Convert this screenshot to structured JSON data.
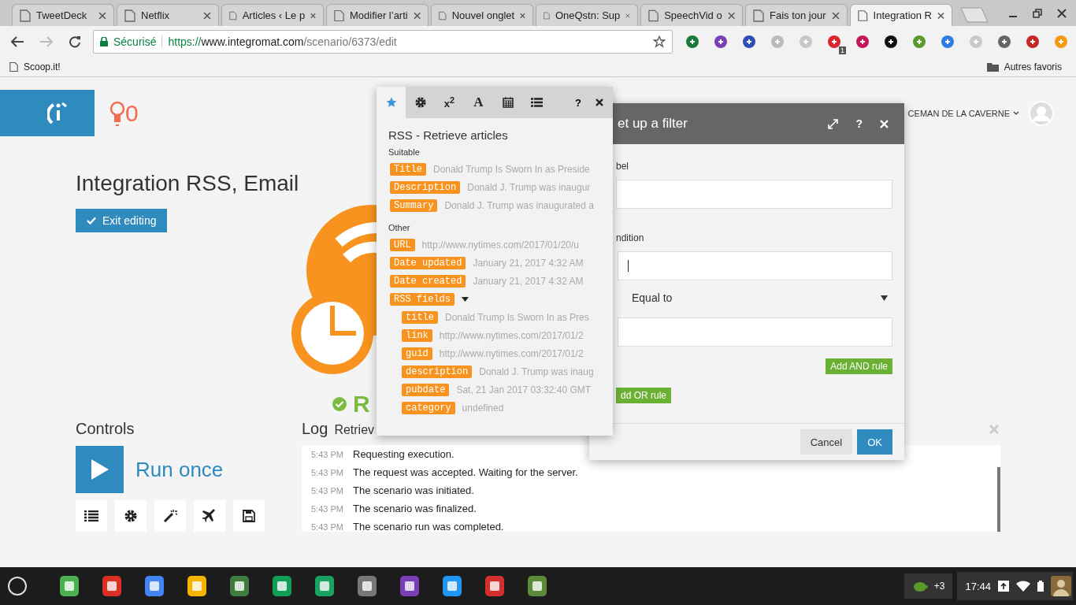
{
  "browser": {
    "tabs": [
      {
        "title": "TweetDeck",
        "selected": false
      },
      {
        "title": "Netflix",
        "selected": false
      },
      {
        "title": "Articles ‹ Le p",
        "selected": false
      },
      {
        "title": "Modifier l’arti",
        "selected": false
      },
      {
        "title": "Nouvel onglet",
        "selected": false
      },
      {
        "title": "OneQstn: Sup",
        "selected": false
      },
      {
        "title": "SpeechVid o",
        "selected": false
      },
      {
        "title": "Fais ton jour",
        "selected": false
      },
      {
        "title": "Integration R",
        "selected": true
      }
    ],
    "security": "Sécurisé",
    "url": {
      "scheme": "https://",
      "host": "www.integromat.com",
      "path": "/scenario/6373/edit"
    },
    "extension_badge": "1",
    "bookmarks": [
      "Scoop.it!"
    ],
    "other_bookmarks": "Autres favoris"
  },
  "app": {
    "notifications": "0",
    "user": "CEMAN DE LA CAVERNE",
    "scenario_title": "Integration RSS, Email",
    "exit_button": "Exit editing",
    "status": "R",
    "controls_heading": "Controls",
    "run_button": "Run once",
    "log_heading": "Log",
    "log_tab": "Retriev",
    "log": [
      {
        "time": "5:43 PM",
        "message": "Requesting execution."
      },
      {
        "time": "5:43 PM",
        "message": "The request was accepted. Waiting for the server."
      },
      {
        "time": "5:43 PM",
        "message": "The scenario was initiated."
      },
      {
        "time": "5:43 PM",
        "message": "The scenario was finalized."
      },
      {
        "time": "5:43 PM",
        "message": "The scenario run was completed."
      }
    ]
  },
  "mapping_panel": {
    "tabs": [
      {
        "kind": "star",
        "selected": true
      },
      {
        "kind": "gear",
        "selected": false
      },
      {
        "kind": "text",
        "label": "x$^{2}$",
        "selected": false
      },
      {
        "kind": "letter",
        "label": "A",
        "selected": false
      },
      {
        "kind": "calendar",
        "selected": false
      },
      {
        "kind": "list",
        "selected": false
      }
    ],
    "help": "?",
    "title": "RSS - Retrieve articles",
    "groups": [
      {
        "heading": "Suitable",
        "items": [
          {
            "label": "Title",
            "value": "Donald Trump Is Sworn In as Preside"
          },
          {
            "label": "Description",
            "value": "Donald J. Trump was inaugur"
          },
          {
            "label": "Summary",
            "value": "Donald J. Trump was inaugurated a"
          }
        ]
      },
      {
        "heading": "Other",
        "items": [
          {
            "label": "URL",
            "value": "http://www.nytimes.com/2017/01/20/u"
          },
          {
            "label": "Date updated",
            "value": "January 21, 2017 4:32 AM"
          },
          {
            "label": "Date created",
            "value": "January 21, 2017 4:32 AM"
          },
          {
            "label": "RSS fields",
            "expanded": true,
            "children": [
              {
                "label": "title",
                "value": "Donald Trump Is Sworn In as Pres"
              },
              {
                "label": "link",
                "value": "http://www.nytimes.com/2017/01/2"
              },
              {
                "label": "guid",
                "value": "http://www.nytimes.com/2017/01/2"
              },
              {
                "label": "description",
                "value": "Donald J. Trump was inaug"
              },
              {
                "label": "pubdate",
                "value": "Sat, 21 Jan 2017 03:32:40 GMT"
              },
              {
                "label": "category",
                "value": "undefined"
              }
            ]
          }
        ]
      }
    ]
  },
  "filter_dialog": {
    "title": "et up a filter",
    "help": "?",
    "label_caption": "bel",
    "condition_caption": "ndition",
    "operator": "Equal to",
    "and_button": "Add AND rule",
    "or_button": "dd OR rule",
    "cancel": "Cancel",
    "ok": "OK"
  },
  "shelf": {
    "notification_count": "+3",
    "time": "17:44"
  }
}
